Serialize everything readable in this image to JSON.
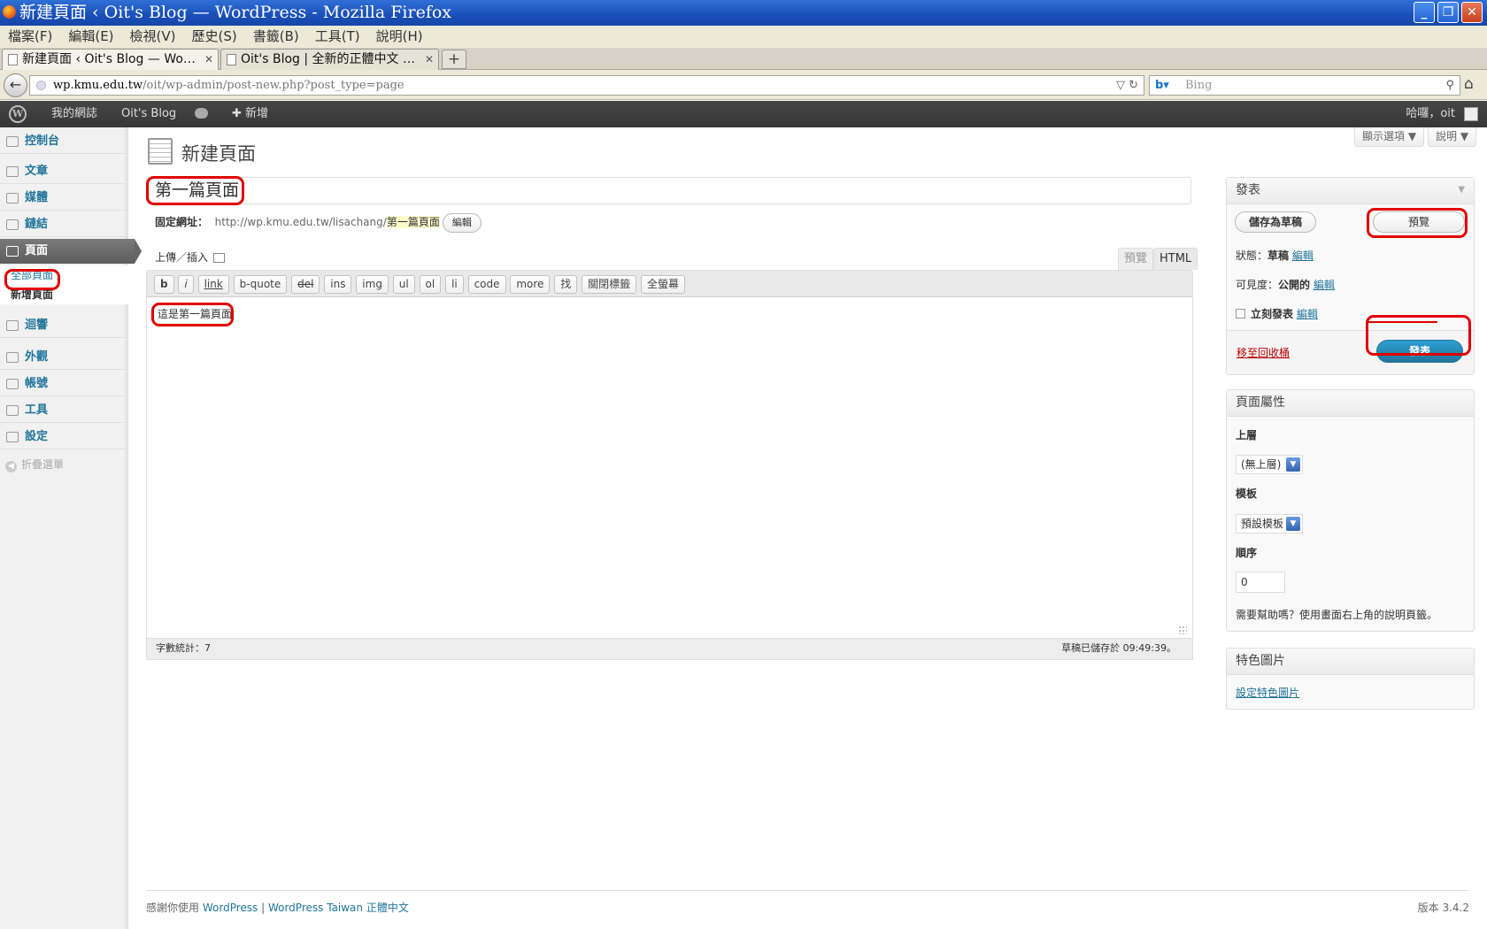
{
  "window": {
    "title": "新建頁面 ‹ Oit's Blog — WordPress - Mozilla Firefox"
  },
  "menubar": [
    "檔案(F)",
    "編輯(E)",
    "檢視(V)",
    "歷史(S)",
    "書籤(B)",
    "工具(T)",
    "說明(H)"
  ],
  "tabs": [
    {
      "label": "新建頁面 ‹ Oit's Blog — Wo…"
    },
    {
      "label": "Oit's Blog | 全新的正體中文 …"
    }
  ],
  "nav": {
    "url_domain": "wp.kmu.edu.tw",
    "url_path": "/oit/wp-admin/post-new.php?post_type=page",
    "search_placeholder": "Bing"
  },
  "adminbar": {
    "my_sites": "我的網誌",
    "blog": "Oit's Blog",
    "new": "新增",
    "greeting": "哈囉，oit"
  },
  "sidebar": {
    "dashboard": "控制台",
    "posts": "文章",
    "media": "媒體",
    "links": "鏈結",
    "pages": "頁面",
    "pages_all": "全部頁面",
    "pages_new": "新增頁面",
    "comments": "迴響",
    "appearance": "外觀",
    "users": "帳號",
    "tools": "工具",
    "settings": "設定",
    "collapse": "折疊選單"
  },
  "screen_options": "顯示選項 ▼",
  "help": "說明 ▼",
  "page": {
    "heading": "新建頁面",
    "title_value": "第一篇頁面",
    "permalink_label": "固定網址：",
    "permalink_base": "http://wp.kmu.edu.tw/lisachang/",
    "permalink_slug": "第一篇頁面",
    "permalink_edit": "編輯",
    "upload_insert": "上傳／插入",
    "tab_visual": "預覽",
    "tab_html": "HTML",
    "content": "這是第一篇頁面",
    "word_count": "字數統計：7",
    "draft_saved": "草稿已儲存於 09:49:39。"
  },
  "quicktags": [
    "b",
    "i",
    "link",
    "b-quote",
    "del",
    "ins",
    "img",
    "ul",
    "ol",
    "li",
    "code",
    "more",
    "找",
    "關閉標籤",
    "全螢幕"
  ],
  "publish": {
    "title": "發表",
    "save_draft": "儲存為草稿",
    "preview": "預覽",
    "status_label": "狀態：",
    "status_value": "草稿",
    "visibility_label": "可見度：",
    "visibility_value": "公開的",
    "schedule": "立刻發表",
    "edit": "編輯",
    "trash": "移至回收桶",
    "publish_btn": "發表"
  },
  "attributes": {
    "title": "頁面屬性",
    "parent_label": "上層",
    "parent_value": "(無上層)",
    "template_label": "模板",
    "template_value": "預設模板",
    "order_label": "順序",
    "order_value": "0",
    "help_text": "需要幫助嗎？使用畫面右上角的說明頁籤。"
  },
  "featured": {
    "title": "特色圖片",
    "link": "設定特色圖片"
  },
  "footer": {
    "thanks": "感謝你使用",
    "wp": "WordPress",
    "sep": " | ",
    "wp_tw": "WordPress Taiwan 正體中文",
    "version": "版本 3.4.2"
  }
}
